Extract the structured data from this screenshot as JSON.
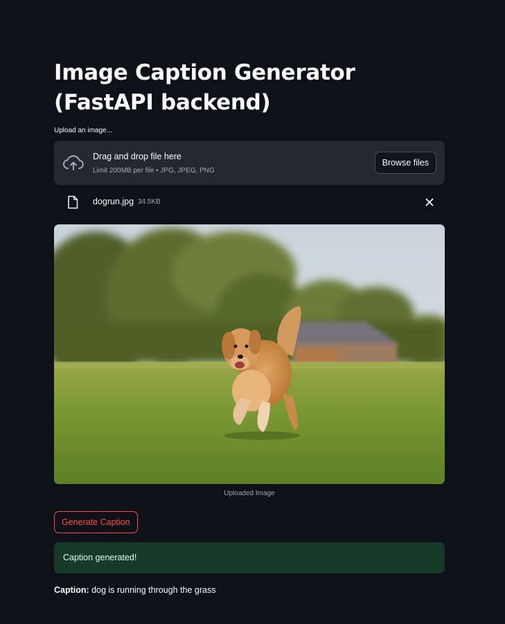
{
  "page": {
    "title": "Image Caption Generator (FastAPI backend)"
  },
  "uploader": {
    "label": "Upload an image...",
    "drop_text": "Drag and drop file here",
    "limit_text": "Limit 200MB per file • JPG, JPEG, PNG",
    "browse_label": "Browse files",
    "cloud_icon": "cloud-upload-icon"
  },
  "file": {
    "name": "dogrun.jpg",
    "size": "34.5KB",
    "file_icon": "file-icon",
    "remove_icon": "close-icon"
  },
  "image": {
    "caption": "Uploaded Image"
  },
  "actions": {
    "generate_label": "Generate Caption"
  },
  "status": {
    "message": "Caption generated!"
  },
  "result": {
    "label": "Caption:",
    "text": "dog is running through the grass"
  },
  "colors": {
    "background": "#0e1117",
    "panel": "#262730",
    "accent": "#ff4b4b",
    "success_bg": "#173928",
    "success_text": "#dffde9"
  }
}
